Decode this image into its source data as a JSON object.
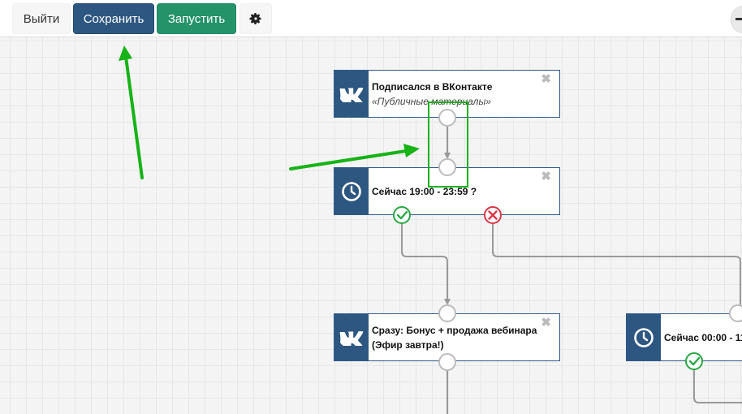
{
  "toolbar": {
    "exit_label": "Выйти",
    "save_label": "Сохранить",
    "run_label": "Запустить",
    "settings_icon": "gear-icon"
  },
  "nodes": [
    {
      "icon": "vk-logo-icon",
      "title": "Подписался в ВКонтакте",
      "subtitle": "«Публичные материалы»"
    },
    {
      "icon": "clock-icon",
      "title": "Сейчас 19:00 - 23:59 ?"
    },
    {
      "icon": "vk-logo-icon",
      "title": "Сразу: Бонус + продажа вебинара (Эфир завтра!)"
    },
    {
      "icon": "clock-icon",
      "title": "Сейчас 00:00 - 11"
    }
  ],
  "colors": {
    "save": "#2d5781",
    "run": "#24936a",
    "node_icon_bg": "#2d5781",
    "yes": "#28a745",
    "no": "#dc3545",
    "annotation_green": "#17b317"
  }
}
